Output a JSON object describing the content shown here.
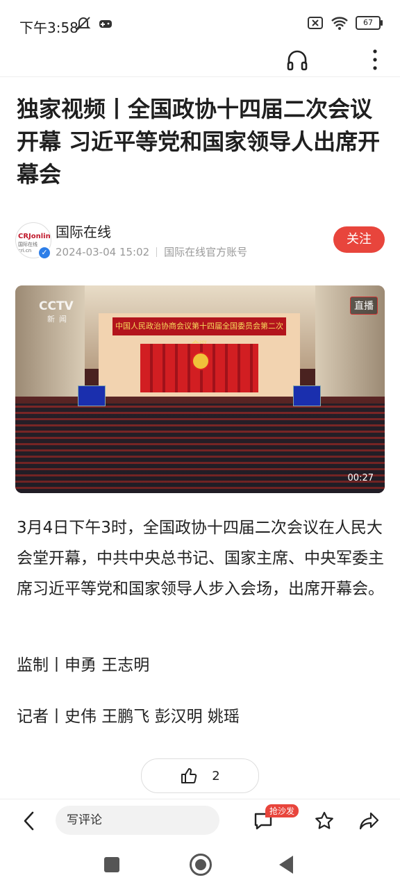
{
  "status": {
    "time": "下午3:58",
    "battery": "67"
  },
  "article": {
    "title": "独家视频丨全国政协十四届二次会议开幕 习近平等党和国家领导人出席开幕会",
    "author": {
      "name": "国际在线",
      "date": "2024-03-04 15:02",
      "account_type": "国际在线官方账号",
      "follow_label": "关注",
      "avatar_logo": "CRJonline",
      "avatar_sub": "国际在线 cri.cn"
    },
    "video": {
      "channel_logo": "CCTV",
      "channel_sub": "新闻",
      "banner_text": "中国人民政治协商会议第十四届全国委员会第二次会议",
      "live_badge": "直播",
      "duration": "00:27"
    },
    "body": "3月4日下午3时，全国政协十四届二次会议在人民大会堂开幕，中共中央总书记、国家主席、中央军委主席习近平等党和国家领导人步入会场，出席开幕会。",
    "credit_supervision": "监制丨申勇 王志明",
    "credit_reporters": "记者丨史伟 王鹏飞 彭汉明 姚瑶",
    "like_count": "2"
  },
  "bottombar": {
    "comment_placeholder": "写评论",
    "sofa_badge": "抢沙发"
  }
}
